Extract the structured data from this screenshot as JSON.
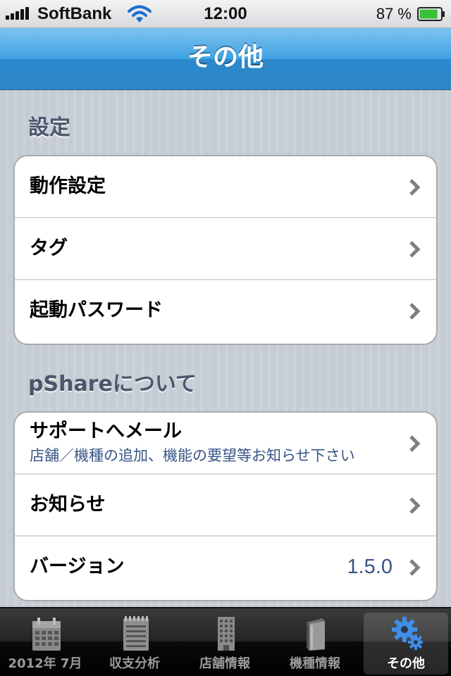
{
  "status_bar": {
    "carrier": "SoftBank",
    "time": "12:00",
    "battery_percent": "87 %",
    "battery_level": 0.87
  },
  "nav": {
    "title": "その他"
  },
  "sections": [
    {
      "header": "設定",
      "rows": [
        {
          "label": "動作設定"
        },
        {
          "label": "タグ"
        },
        {
          "label": "起動パスワード"
        }
      ]
    },
    {
      "header": "pShareについて",
      "rows": [
        {
          "label": "サポートへメール",
          "subtitle": "店舗／機種の追加、機能の要望等お知らせ下さい"
        },
        {
          "label": "お知らせ"
        },
        {
          "label": "バージョン",
          "value": "1.5.0"
        }
      ]
    }
  ],
  "tabs": [
    {
      "label": "2012年 7月",
      "icon": "calendar-icon",
      "selected": false
    },
    {
      "label": "収支分析",
      "icon": "notepad-icon",
      "selected": false
    },
    {
      "label": "店舗情報",
      "icon": "building-icon",
      "selected": false
    },
    {
      "label": "機種情報",
      "icon": "book-icon",
      "selected": false
    },
    {
      "label": "その他",
      "icon": "gears-icon",
      "selected": true
    }
  ],
  "colors": {
    "nav_blue": "#2f86c6",
    "detail_text": "#385487",
    "section_header": "#4c566c",
    "selected_tab_icon": "#3f8ee8"
  }
}
